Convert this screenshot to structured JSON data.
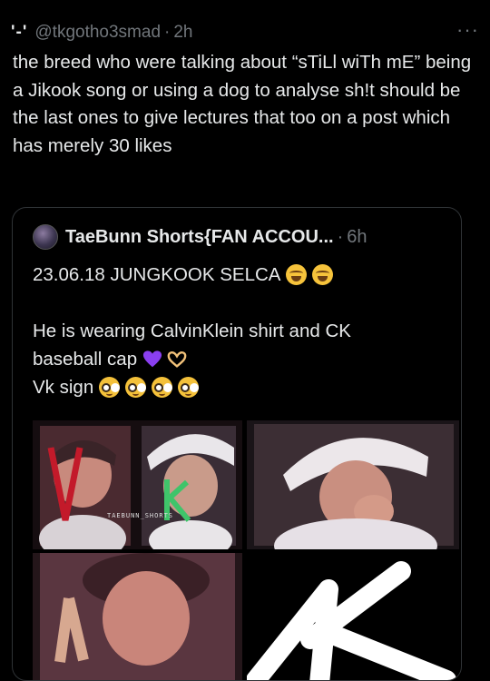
{
  "tweet": {
    "display_name": "'-'",
    "handle": "@tkgotho3smad",
    "separator": "·",
    "time": "2h",
    "more_label": "···",
    "text": "the breed who were talking about “sTiLl wiTh mE” being a Jikook song or using a dog to analyse sh!t should be the last ones to give lectures that too on a post which has merely 30 likes"
  },
  "quote": {
    "display_name": "TaeBunn Shorts{FAN ACCOU...",
    "separator": "·",
    "time": "6h",
    "line1": "23.06.18 JUNGKOOK SELCA",
    "line3": "He is wearing CalvinKlein shirt and CK",
    "line4": "baseball cap",
    "line5": "Vk sign",
    "watermark": "TAEBUNN_SHORTS",
    "colors": {
      "heart": "#8a3ff0",
      "border": "#2f3336",
      "muted": "#71767b"
    }
  }
}
